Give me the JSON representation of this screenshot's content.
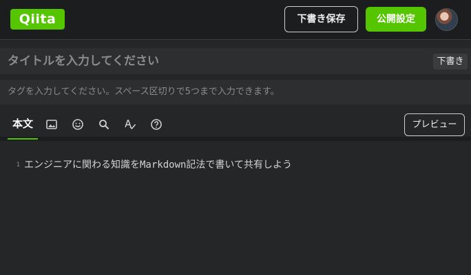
{
  "header": {
    "logo_text": "Qiita",
    "draft_save_label": "下書き保存",
    "publish_settings_label": "公開設定"
  },
  "title": {
    "placeholder": "タイトルを入力してください",
    "draft_badge": "下書き"
  },
  "tags": {
    "placeholder": "タグを入力してください。スペース区切りで5つまで入力できます。"
  },
  "toolbar": {
    "body_tab_label": "本文",
    "tools": [
      "image-icon",
      "emoji-icon",
      "search-icon",
      "spellcheck-icon",
      "help-icon"
    ],
    "preview_label": "プレビュー"
  },
  "editor": {
    "line_number": "1",
    "placeholder": "エンジニアに関わる知識をMarkdown記法で書いて共有しよう"
  },
  "colors": {
    "accent": "#55c500",
    "background": "#242628",
    "header_background": "#1c1d1f",
    "input_background": "#2c2e30"
  }
}
